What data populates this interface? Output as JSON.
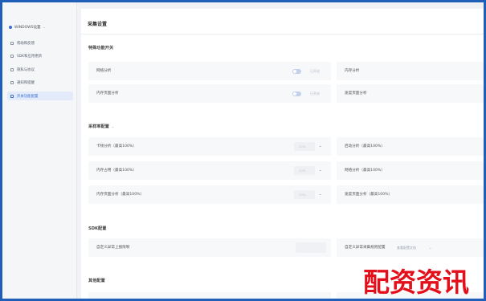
{
  "sidebar": {
    "workspace": "WINDOWS设置",
    "items": [
      {
        "label": "帮助和反馈",
        "active": false
      },
      {
        "label": "SDK和应用更新",
        "active": false
      },
      {
        "label": "隐私与协议",
        "active": false
      },
      {
        "label": "通知和提醒",
        "active": false
      },
      {
        "label": "开关功能配置",
        "active": true
      }
    ]
  },
  "main": {
    "title": "采集设置",
    "sections": {
      "features": {
        "title": "特殊功能开关",
        "left": [
          {
            "label": "网络分析",
            "toggle": "已开启"
          },
          {
            "label": "内存页面分析",
            "toggle": "已开启"
          }
        ],
        "right": [
          {
            "label": "内存分析"
          },
          {
            "label": "速度页面分析"
          }
        ]
      },
      "sampling": {
        "title": "采样率配置",
        "left": [
          {
            "label": "卡顿分析（最高100%）",
            "value": "10%"
          },
          {
            "label": "内存占用（最高100%）",
            "value": "10%"
          },
          {
            "label": "内存页面分析（最高100%）",
            "value": "10%"
          }
        ],
        "right": [
          {
            "label": "启动分析（最高100%）"
          },
          {
            "label": "网络分析（最高100%）"
          },
          {
            "label": "速度页面分析（最高100%）"
          }
        ]
      },
      "sdk": {
        "title": "SDK配置",
        "left_label": "自定义异常上报限制",
        "right_label": "自定义异常采集规则配置",
        "right_link": "查看配置文档"
      },
      "other": {
        "title": "其他配置"
      }
    }
  },
  "watermark": "配资资讯"
}
